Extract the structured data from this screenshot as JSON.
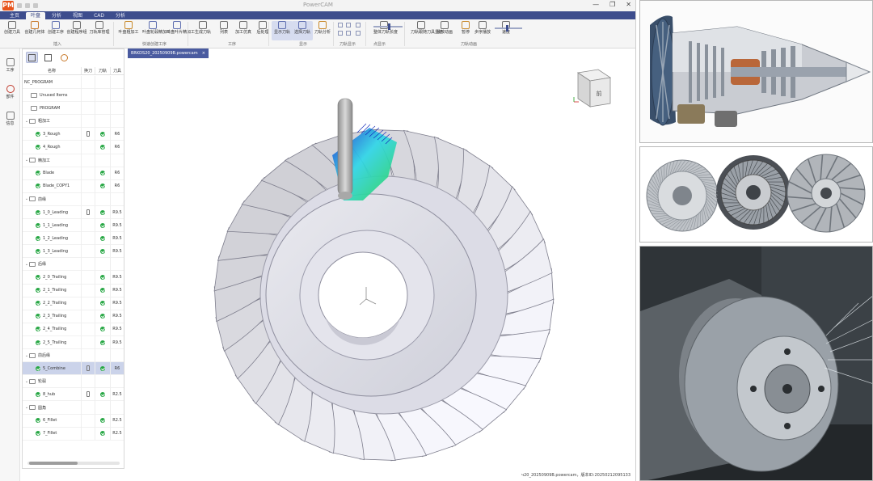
{
  "window": {
    "title": "PowerCAM",
    "logo": "PM",
    "controls": [
      "—",
      "❐",
      "✕"
    ]
  },
  "menu_tabs": [
    {
      "label": "主页",
      "active": false
    },
    {
      "label": "叶盘",
      "active": true
    },
    {
      "label": "分析",
      "active": false
    },
    {
      "label": "视图",
      "active": false
    },
    {
      "label": "CAD",
      "active": false
    },
    {
      "label": "分析",
      "active": false
    }
  ],
  "ribbon": {
    "buttons": [
      {
        "label": "创建刀具",
        "icon": "tool-create-icon",
        "color": "#6d6d6d"
      },
      {
        "label": "创建几何体",
        "icon": "geometry-icon",
        "color": "#c97a2b"
      },
      {
        "label": "创建工序",
        "icon": "operation-icon",
        "color": "#5f6fb0"
      },
      {
        "label": "创建程序组",
        "icon": "program-group-icon",
        "color": "#6d6d6d"
      },
      {
        "label": "刀轨库管理",
        "icon": "toolpath-library-icon",
        "color": "#6d6d6d"
      },
      {
        "label": "叶盘粗加工",
        "icon": "blisk-rough-icon",
        "color": "#c98a2b"
      },
      {
        "label": "叶盘轮毂精加工",
        "icon": "hub-finish-icon",
        "color": "#5f6fb0"
      },
      {
        "label": "叶盘叶片精加工",
        "icon": "blade-finish-icon",
        "color": "#5f6fb0"
      },
      {
        "label": "生成刀轨",
        "icon": "generate-toolpath-icon",
        "color": "#6d6d6d"
      },
      {
        "label": "列表",
        "icon": "list-icon",
        "color": "#6d6d6d"
      },
      {
        "label": "加工仿真",
        "icon": "simulation-icon",
        "color": "#6d6d6d"
      },
      {
        "label": "后处理",
        "icon": "post-process-icon",
        "color": "#6d6d6d"
      },
      {
        "label": "显示刀轨",
        "icon": "show-toolpath-icon",
        "color": "#5f6fb0"
      },
      {
        "label": "选择刀轨",
        "icon": "select-toolpath-icon",
        "color": "#5f6fb0"
      },
      {
        "label": "刀轨分析",
        "icon": "toolpath-analysis-icon",
        "color": "#c98a2b"
      },
      {
        "label": "整体刀轨长度",
        "icon": "toolpath-length-icon",
        "color": "#6d6d6d"
      },
      {
        "label": "刀轨跟随刀具显示",
        "icon": "follow-tool-icon",
        "color": "#6d6d6d"
      },
      {
        "label": "播放动画",
        "icon": "play-icon",
        "color": "#6d6d6d"
      },
      {
        "label": "暂停",
        "icon": "pause-icon",
        "color": "#c98a2b"
      },
      {
        "label": "步序播放",
        "icon": "step-play-icon",
        "color": "#6d6d6d"
      },
      {
        "label": "速度",
        "icon": "speed-icon",
        "color": "#6d6d6d"
      }
    ],
    "groups": [
      "插入",
      "快速创建工序",
      "工序",
      "显示",
      "刀轨显示",
      "点显示",
      "刀轨动画"
    ]
  },
  "left_toolbar": [
    {
      "label": "工序",
      "icon": "operation-nav-icon"
    },
    {
      "label": "部件",
      "icon": "part-icon"
    },
    {
      "label": "信息",
      "icon": "info-icon"
    }
  ],
  "tree": {
    "columns": [
      "名称",
      "换刀",
      "刀轨",
      "刀具"
    ],
    "rows": [
      {
        "kind": "root",
        "name": "NC_PROGRAM",
        "tool": false,
        "ok": false,
        "knife": ""
      },
      {
        "kind": "folder",
        "name": "Unused Items",
        "tool": false,
        "ok": false,
        "knife": ""
      },
      {
        "kind": "folder",
        "name": "PROGRAM",
        "tool": false,
        "ok": false,
        "knife": ""
      },
      {
        "kind": "group",
        "name": "粗加工",
        "tool": false,
        "ok": false,
        "knife": ""
      },
      {
        "kind": "op",
        "name": "3_Rough",
        "tool": true,
        "ok": true,
        "knife": "R6"
      },
      {
        "kind": "op",
        "name": "4_Rough",
        "tool": false,
        "ok": true,
        "knife": "R6"
      },
      {
        "kind": "group",
        "name": "精加工",
        "tool": false,
        "ok": false,
        "knife": ""
      },
      {
        "kind": "op",
        "name": "Blade",
        "tool": false,
        "ok": true,
        "knife": "R6"
      },
      {
        "kind": "op",
        "name": "Blade_COPY1",
        "tool": false,
        "ok": true,
        "knife": "R6"
      },
      {
        "kind": "group",
        "name": "前缘",
        "tool": false,
        "ok": false,
        "knife": ""
      },
      {
        "kind": "op",
        "name": "1_0_Leading",
        "tool": true,
        "ok": true,
        "knife": "R9.5"
      },
      {
        "kind": "op",
        "name": "1_1_Leading",
        "tool": false,
        "ok": true,
        "knife": "R9.5"
      },
      {
        "kind": "op",
        "name": "1_2_Leading",
        "tool": false,
        "ok": true,
        "knife": "R9.5"
      },
      {
        "kind": "op",
        "name": "1_3_Leading",
        "tool": false,
        "ok": true,
        "knife": "R9.5"
      },
      {
        "kind": "group",
        "name": "后缘",
        "tool": false,
        "ok": false,
        "knife": ""
      },
      {
        "kind": "op",
        "name": "2_0_Trailing",
        "tool": false,
        "ok": true,
        "knife": "R9.5"
      },
      {
        "kind": "op",
        "name": "2_1_Trailing",
        "tool": false,
        "ok": true,
        "knife": "R9.5"
      },
      {
        "kind": "op",
        "name": "2_2_Trailing",
        "tool": false,
        "ok": true,
        "knife": "R9.5"
      },
      {
        "kind": "op",
        "name": "2_3_Trailing",
        "tool": false,
        "ok": true,
        "knife": "R9.5"
      },
      {
        "kind": "op",
        "name": "2_4_Trailing",
        "tool": false,
        "ok": true,
        "knife": "R9.5"
      },
      {
        "kind": "op",
        "name": "2_5_Trailing",
        "tool": false,
        "ok": true,
        "knife": "R9.5"
      },
      {
        "kind": "group",
        "name": "前后缘",
        "tool": false,
        "ok": false,
        "knife": ""
      },
      {
        "kind": "op",
        "name": "5_Combine",
        "tool": true,
        "ok": true,
        "knife": "R6",
        "selected": true
      },
      {
        "kind": "group",
        "name": "轮毂",
        "tool": false,
        "ok": false,
        "knife": ""
      },
      {
        "kind": "op",
        "name": "8_hub",
        "tool": true,
        "ok": true,
        "knife": "R2.5"
      },
      {
        "kind": "group",
        "name": "圆角",
        "tool": false,
        "ok": false,
        "knife": ""
      },
      {
        "kind": "op",
        "name": "6_Fillet",
        "tool": false,
        "ok": true,
        "knife": "R2.5"
      },
      {
        "kind": "op",
        "name": "7_Fillet",
        "tool": false,
        "ok": true,
        "knife": "R2.5"
      }
    ]
  },
  "document_tab": {
    "label": "BRKDS20_20250909B.powercam",
    "close": "×"
  },
  "status": "ч20_20250909B.powercam，版本ID:20250212095133",
  "view_cube_label": "前",
  "colors": {
    "menubar": "#3d4d8d",
    "accent": "#4a5ba0",
    "ok_green": "#27a744",
    "selected_row": "#cbd3ea",
    "toolpath_green": "#2bd64f",
    "toolpath_blue": "#1f3fd1"
  }
}
